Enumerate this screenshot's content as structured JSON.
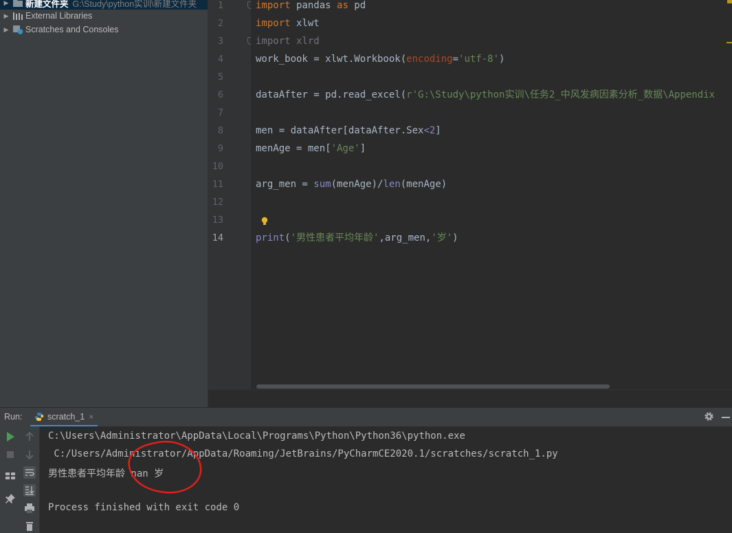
{
  "project_tree": {
    "items": [
      {
        "label": "新建文件夹",
        "path": "G:\\Study\\python实训\\新建文件夹",
        "icon": "folder-icon"
      },
      {
        "label": "External Libraries",
        "icon": "library-icon"
      },
      {
        "label": "Scratches and Consoles",
        "icon": "scratches-icon"
      }
    ]
  },
  "editor": {
    "line_numbers": [
      "1",
      "2",
      "3",
      "4",
      "5",
      "6",
      "7",
      "8",
      "9",
      "10",
      "11",
      "12",
      "13",
      "14"
    ],
    "current_line": "14",
    "code": [
      {
        "segments": [
          [
            "kw",
            "import"
          ],
          [
            "t",
            " pandas "
          ],
          [
            "kw",
            "as"
          ],
          [
            "t",
            " pd"
          ]
        ]
      },
      {
        "segments": [
          [
            "kw",
            "import"
          ],
          [
            "t",
            " xlwt"
          ]
        ]
      },
      {
        "segments": [
          [
            "dim",
            "import xlrd"
          ]
        ]
      },
      {
        "segments": [
          [
            "t",
            "work_book = xlwt.Workbook"
          ],
          [
            "paren",
            "("
          ],
          [
            "param",
            "encoding"
          ],
          [
            "t",
            "="
          ],
          [
            "str",
            "'utf-8'"
          ],
          [
            "paren",
            ")"
          ]
        ]
      },
      {
        "segments": []
      },
      {
        "segments": [
          [
            "t",
            "dataAfter = pd.read_excel"
          ],
          [
            "paren",
            "("
          ],
          [
            "str",
            "r'G:\\Study\\python实训\\任务2_中风发病因素分析_数据\\Appendix"
          ]
        ]
      },
      {
        "segments": []
      },
      {
        "segments": [
          [
            "t",
            "men = dataAfter[dataAfter.Sex"
          ],
          [
            "builtin",
            "<2"
          ],
          [
            "t",
            "]"
          ]
        ]
      },
      {
        "segments": [
          [
            "t",
            "menAge = men["
          ],
          [
            "str",
            "'Age'"
          ],
          [
            "t",
            "]"
          ]
        ]
      },
      {
        "segments": []
      },
      {
        "segments": [
          [
            "t",
            "arg_men = "
          ],
          [
            "builtin",
            "sum"
          ],
          [
            "t",
            "(menAge)/"
          ],
          [
            "builtin",
            "len"
          ],
          [
            "t",
            "(menAge)"
          ]
        ]
      },
      {
        "segments": []
      },
      {
        "segments": []
      },
      {
        "segments": [
          [
            "builtin",
            "print"
          ],
          [
            "t",
            "("
          ],
          [
            "str",
            "'男性患者平均年龄'"
          ],
          [
            "t",
            ",arg_men,"
          ],
          [
            "str",
            "'岁'"
          ],
          [
            "t",
            ")"
          ]
        ]
      }
    ]
  },
  "run_panel": {
    "title": "Run:",
    "tab_label": "scratch_1",
    "tab_close": "×",
    "console_lines": [
      "C:\\Users\\Administrator\\AppData\\Local\\Programs\\Python\\Python36\\python.exe",
      " C:/Users/Administrator/AppData/Roaming/JetBrains/PyCharmCE2020.1/scratches/scratch_1.py",
      "男性患者平均年龄 nan 岁",
      "",
      "Process finished with exit code 0"
    ]
  },
  "colors": {
    "keyword": "#cc7832",
    "string": "#6a8759",
    "builtin": "#8888c6",
    "param": "#aa4926",
    "annotation_circle": "#e0201b"
  }
}
